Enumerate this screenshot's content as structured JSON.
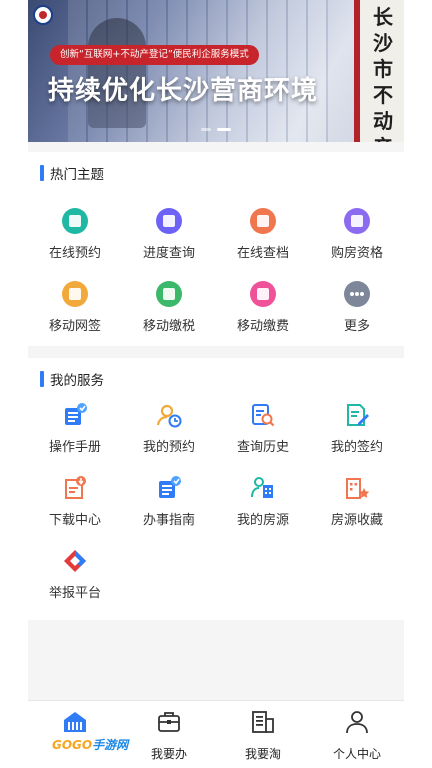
{
  "banner": {
    "tagline": "创新“互联网+不动产登记”便民利企服务模式",
    "headline": "持续优化长沙营商环境",
    "pillar_text": "长沙市不动产",
    "active_slide": 2,
    "slides": 3
  },
  "hot": {
    "title": "热门主题",
    "items": [
      {
        "label": "在线预约",
        "icon": "calendar-icon",
        "color": "#1fb8a4"
      },
      {
        "label": "进度查询",
        "icon": "search-icon",
        "color": "#6c63f6"
      },
      {
        "label": "在线查档",
        "icon": "document-icon",
        "color": "#f0764f"
      },
      {
        "label": "购房资格",
        "icon": "building-icon",
        "color": "#8b6cf0"
      },
      {
        "label": "移动网签",
        "icon": "sign-icon",
        "color": "#f2a93b"
      },
      {
        "label": "移动缴税",
        "icon": "tax-icon",
        "color": "#3cb86b"
      },
      {
        "label": "移动缴费",
        "icon": "payment-icon",
        "color": "#f0529a"
      },
      {
        "label": "更多",
        "icon": "more-icon",
        "color": "#7d8799"
      }
    ]
  },
  "services": {
    "title": "我的服务",
    "items": [
      {
        "label": "操作手册",
        "icon": "manual-icon"
      },
      {
        "label": "我的预约",
        "icon": "appointment-icon"
      },
      {
        "label": "查询历史",
        "icon": "history-icon"
      },
      {
        "label": "我的签约",
        "icon": "contract-icon"
      },
      {
        "label": "下载中心",
        "icon": "download-icon"
      },
      {
        "label": "办事指南",
        "icon": "guide-icon"
      },
      {
        "label": "我的房源",
        "icon": "my-house-icon"
      },
      {
        "label": "房源收藏",
        "icon": "favorite-house-icon"
      },
      {
        "label": "举报平台",
        "icon": "report-icon"
      }
    ]
  },
  "tabbar": {
    "items": [
      {
        "label": "",
        "icon": "home-icon",
        "active": true
      },
      {
        "label": "我要办",
        "icon": "briefcase-icon"
      },
      {
        "label": "我要淘",
        "icon": "house-list-icon"
      },
      {
        "label": "个人中心",
        "icon": "user-icon"
      }
    ]
  },
  "watermark": {
    "part1": "GOGO",
    "part2": "手游网"
  }
}
